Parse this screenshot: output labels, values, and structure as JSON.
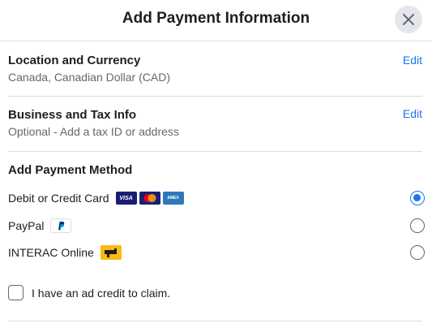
{
  "header": {
    "title": "Add Payment Information",
    "close_icon": "close-icon"
  },
  "location": {
    "title": "Location and Currency",
    "subtitle": "Canada, Canadian Dollar (CAD)",
    "edit_label": "Edit"
  },
  "business": {
    "title": "Business and Tax Info",
    "subtitle": "Optional - Add a tax ID or address",
    "edit_label": "Edit"
  },
  "payment": {
    "title": "Add Payment Method",
    "methods": [
      {
        "label": "Debit or Credit Card",
        "selected": true,
        "icons": [
          "visa-logo",
          "mastercard-logo",
          "amex-logo"
        ]
      },
      {
        "label": "PayPal",
        "selected": false,
        "icons": [
          "paypal-logo"
        ]
      },
      {
        "label": "INTERAC Online",
        "selected": false,
        "icons": [
          "interac-logo"
        ]
      }
    ],
    "card_logo_text": {
      "visa": "VISA",
      "amex": "AMEX"
    }
  },
  "ad_credit": {
    "label": "I have an ad credit to claim.",
    "checked": false
  },
  "colors": {
    "accent": "#1877f2",
    "text": "#1c1e21",
    "muted": "#65676b",
    "divider": "#dadde1"
  }
}
